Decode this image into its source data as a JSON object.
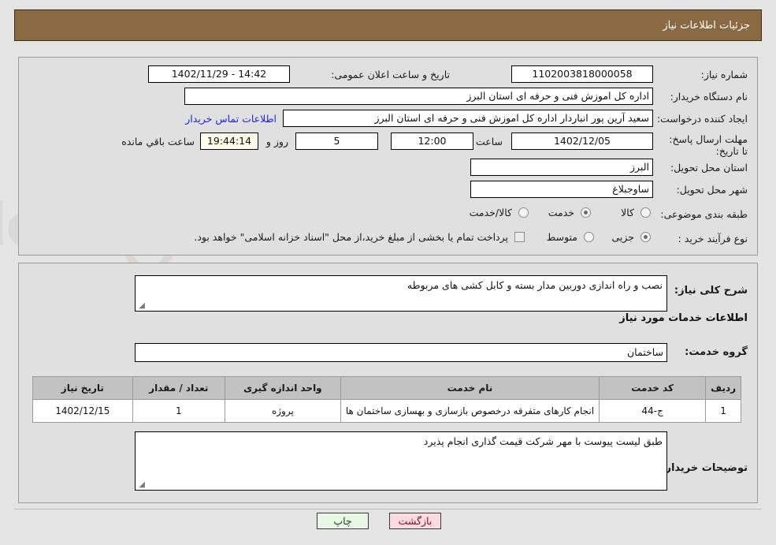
{
  "header": {
    "title": "جزئیات اطلاعات نیاز"
  },
  "form": {
    "need_number_label": "شماره نیاز:",
    "need_number_value": "1102003818000058",
    "announce_label": "تاریخ و ساعت اعلان عمومی:",
    "announce_value": "14:42 - 1402/11/29",
    "buyer_org_label": "نام دستگاه خریدار:",
    "buyer_org_value": "اداره کل اموزش فنی و حرفه ای استان البرز",
    "creator_label": "ایجاد کننده درخواست:",
    "creator_value": "سعید آرین پور انباردار اداره کل اموزش فنی و حرفه ای استان البرز",
    "contact_link": "اطلاعات تماس خریدار",
    "deadline_label": "مهلت ارسال پاسخ: تا تاریخ:",
    "deadline_date": "1402/12/05",
    "hour_label": "ساعت",
    "hour_value": "12:00",
    "days_value": "5",
    "days_and_label": "روز و",
    "countdown_value": "19:44:14",
    "remaining_label": "ساعت باقي مانده",
    "province_label": "استان محل تحویل:",
    "province_value": "البرز",
    "city_label": "شهر محل تحویل:",
    "city_value": "ساوجبلاغ",
    "category_label": "طبقه بندی موضوعی:",
    "category_options": [
      {
        "label": "کالا",
        "selected": false
      },
      {
        "label": "خدمت",
        "selected": true
      },
      {
        "label": "کالا/خدمت",
        "selected": false
      }
    ],
    "process_label": "نوع فرآیند خرید :",
    "process_options": [
      {
        "label": "جزیی",
        "selected": true
      },
      {
        "label": "متوسط",
        "selected": false
      }
    ],
    "treasury_checkbox_text": "پرداخت تمام یا بخشی از مبلغ خرید،از محل \"اسناد خزانه اسلامی\" خواهد بود."
  },
  "description": {
    "general_label": "شرح کلی نیاز:",
    "general_value": "نصب و راه اندازی دوربین مدار بسته و کابل کشی های مربوطه",
    "services_heading": "اطلاعات خدمات مورد نیاز",
    "service_group_label": "گروه خدمت:",
    "service_group_value": "ساختمان"
  },
  "table": {
    "headers": [
      "ردیف",
      "کد خدمت",
      "نام خدمت",
      "واحد اندازه گیری",
      "تعداد / مقدار",
      "تاریخ نیاز"
    ],
    "rows": [
      {
        "row": "1",
        "code": "ج-44",
        "name": "انجام کارهای متفرقه درخصوص بازسازی و بهسازی ساختمان ها",
        "unit": "پروژه",
        "qty": "1",
        "need_date": "1402/12/15"
      }
    ]
  },
  "buyer_notes": {
    "label": "توضیحات خریدار:",
    "value": "طبق لیست پیوست با مهر شرکت قیمت گذاری انجام پذیرد"
  },
  "footer": {
    "print_label": "چاپ",
    "back_label": "بازگشت"
  },
  "watermark": {
    "text": "AriaTender.net"
  },
  "colors": {
    "header_bar": "#8a6a42",
    "page_bg": "#e4e4e4",
    "panel_bg": "#e0e0e0",
    "link": "#1c24d8",
    "table_header": "#c2c2c2",
    "back_button_bg": "#fadce0",
    "print_button_bg": "#e9f7e6",
    "countdown_bg": "#fbfbe7"
  }
}
